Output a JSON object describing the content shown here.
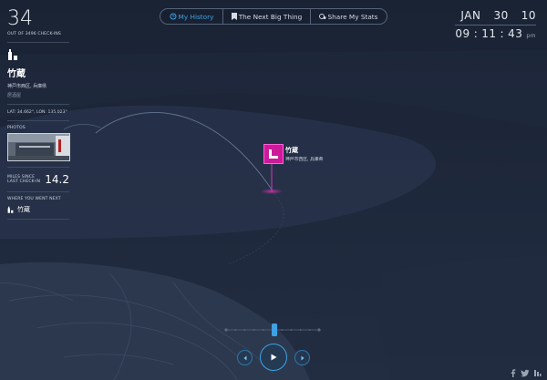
{
  "nav": {
    "my_history": "My History",
    "next_big_thing": "The Next Big Thing",
    "share_stats": "Share My Stats"
  },
  "clock": {
    "month": "JAN",
    "day": "30",
    "year": "10",
    "hour": "09",
    "minute": "11",
    "second": "43",
    "ampm": "pm"
  },
  "stats": {
    "checkin_number": "34",
    "checkin_total_label": "OUT OF 3496 CHECK-INS"
  },
  "venue": {
    "name": "竹蔵",
    "address": "神戸市西区, 兵庫県",
    "category": "居酒屋",
    "coords": "LAT: 34.662°, LON: 135.023°",
    "photos_label": "PHOTOS",
    "miles_label_1": "MILES SINCE",
    "miles_label_2": "LAST CHECK-IN",
    "miles_value": "14.2",
    "next_label": "WHERE YOU WENT NEXT",
    "next_name": "竹蔵"
  },
  "pin": {
    "name": "竹蔵",
    "address": "神戸市西区, 兵庫県"
  },
  "playback": {
    "position": 0.52
  },
  "colors": {
    "accent": "#3fa2e6",
    "pin": "#cc1a9b",
    "background": "#1c2638"
  },
  "icons": [
    "history-icon",
    "bookmark-icon",
    "share-stats-icon",
    "drink-category-icon",
    "prev-icon",
    "play-icon",
    "next-icon",
    "facebook-icon",
    "twitter-icon",
    "foursquare-icon"
  ]
}
